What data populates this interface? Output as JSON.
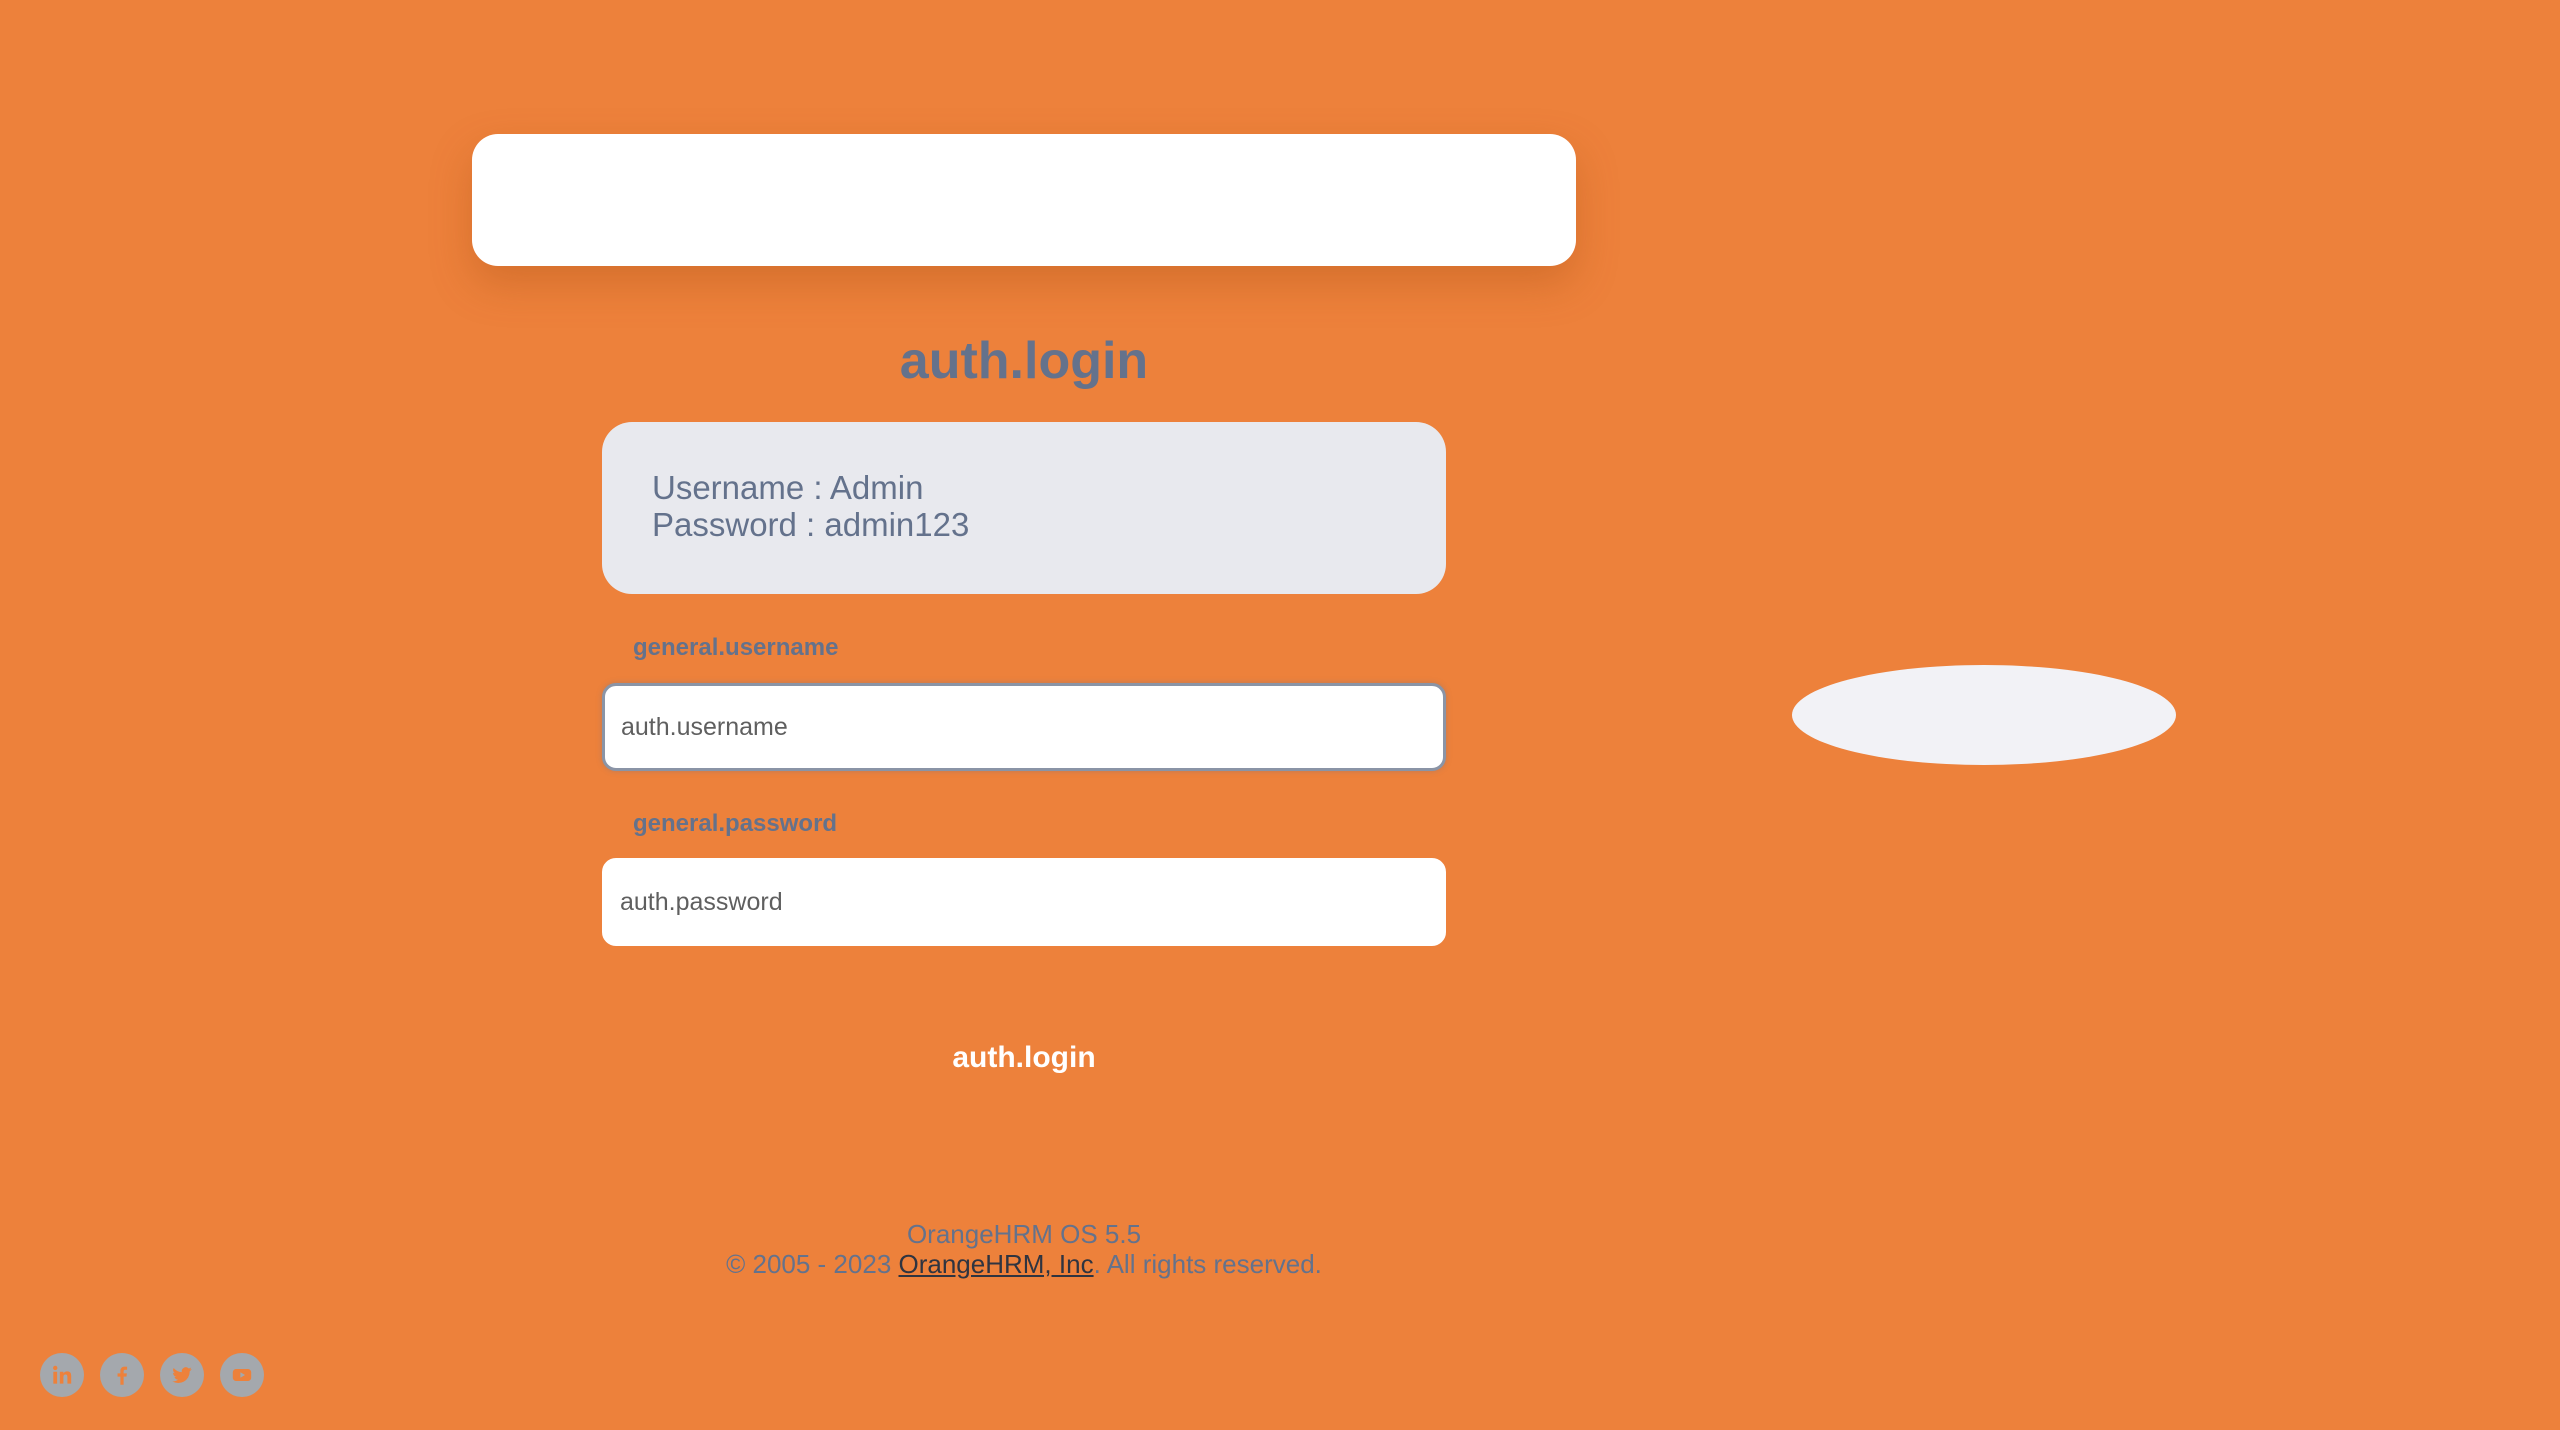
{
  "login": {
    "title": "auth.login",
    "credentials": {
      "username_line": "Username : Admin",
      "password_line": "Password : admin123"
    },
    "username": {
      "label": "general.username",
      "placeholder": "auth.username",
      "value": ""
    },
    "password": {
      "label": "general.password",
      "placeholder": "auth.password",
      "value": ""
    },
    "submit_label": "auth.login"
  },
  "footer": {
    "version": "OrangeHRM OS 5.5",
    "copyright_prefix": "© 2005 - 2023 ",
    "company_link": "OrangeHRM, Inc",
    "copyright_suffix": ". All rights reserved."
  },
  "social": [
    {
      "icon": "linkedin-icon"
    },
    {
      "icon": "facebook-icon"
    },
    {
      "icon": "twitter-icon"
    },
    {
      "icon": "youtube-icon"
    }
  ],
  "colors": {
    "background": "#ED813B",
    "text": "#64728C",
    "card": "#FFFFFF",
    "credentials_bg": "#E8E9EE"
  }
}
